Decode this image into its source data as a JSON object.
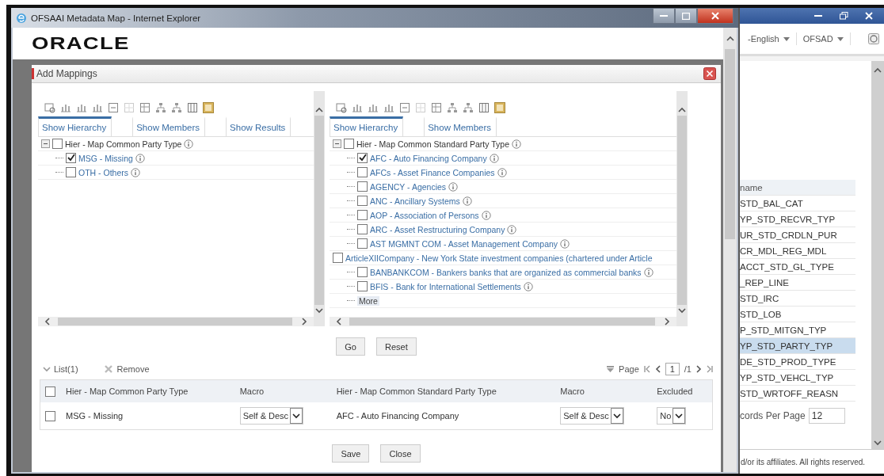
{
  "background_window": {
    "language": "-English",
    "user": "OFSAD",
    "column_header": "name",
    "rows": [
      {
        "text": "STD_BAL_CAT",
        "selected": false
      },
      {
        "text": "YP_STD_RECVR_TYP",
        "selected": false
      },
      {
        "text": "UR_STD_CRDLN_PUR",
        "selected": false
      },
      {
        "text": "CR_MDL_REG_MDL",
        "selected": false
      },
      {
        "text": "ACCT_STD_GL_TYPE",
        "selected": false
      },
      {
        "text": "_REP_LINE",
        "selected": false
      },
      {
        "text": "STD_IRC",
        "selected": false
      },
      {
        "text": "STD_LOB",
        "selected": false
      },
      {
        "text": "P_STD_MITGN_TYP",
        "selected": false
      },
      {
        "text": "YP_STD_PARTY_TYP",
        "selected": true
      },
      {
        "text": "DE_STD_PROD_TYPE",
        "selected": false
      },
      {
        "text": "YP_STD_VEHCL_TYP",
        "selected": false
      },
      {
        "text": "STD_WRTOFF_REASN",
        "selected": false
      }
    ],
    "records_per_page_label": "cords Per Page",
    "records_per_page": "12",
    "footer": "d/or its affiliates. All rights reserved."
  },
  "window": {
    "title": "OFSAAI Metadata Map - Internet Explorer"
  },
  "logo": "ORACLE",
  "dialog": {
    "title": "Add Mappings",
    "panels": [
      {
        "tabs": [
          {
            "label": "Show Hierarchy",
            "selected": true
          },
          {
            "label": "Show Members",
            "selected": false
          },
          {
            "label": "Show Results",
            "selected": false
          }
        ],
        "tree": [
          {
            "label": "Hier - Map Common Party Type",
            "checked": false,
            "expanded": true,
            "info": true,
            "children": [
              {
                "label": "MSG - Missing",
                "checked": true,
                "info": true
              },
              {
                "label": "OTH - Others",
                "checked": false,
                "info": true
              }
            ]
          }
        ]
      },
      {
        "tabs": [
          {
            "label": "Show Hierarchy",
            "selected": true
          },
          {
            "label": "Show Members",
            "selected": false
          }
        ],
        "tree": [
          {
            "label": "Hier - Map Common Standard Party Type",
            "checked": false,
            "expanded": true,
            "info": true,
            "children": [
              {
                "label": "AFC - Auto Financing Company",
                "checked": true,
                "info": true
              },
              {
                "label": "AFCs - Asset Finance Companies",
                "checked": false,
                "info": true
              },
              {
                "label": "AGENCY - Agencies",
                "checked": false,
                "info": true
              },
              {
                "label": "ANC - Ancillary Systems",
                "checked": false,
                "info": true
              },
              {
                "label": "AOP - Association of Persons",
                "checked": false,
                "info": true
              },
              {
                "label": "ARC - Asset Restructuring Company",
                "checked": false,
                "info": true
              },
              {
                "label": "AST MGMNT COM - Asset Management Company",
                "checked": false,
                "info": true
              }
            ]
          },
          {
            "label": "ArticleXIICompany - New York State investment companies (chartered under Article",
            "checked": false,
            "info": false,
            "children": [
              {
                "label": "BANBANKCOM - Bankers banks that are organized as commercial banks",
                "checked": false,
                "info": true
              },
              {
                "label": "BFIS - Bank for International Settlements",
                "checked": false,
                "info": true
              },
              {
                "kind": "more",
                "label": "More"
              }
            ]
          }
        ]
      }
    ],
    "buttons": [
      "Go",
      "Reset"
    ],
    "list": {
      "title": "List(1)",
      "remove": "Remove",
      "page_label": "Page",
      "page": "1",
      "page_total": "/1",
      "all_checked": false,
      "columns": [
        "Hier - Map Common Party Type",
        "Macro",
        "Hier - Map Common Standard Party Type",
        "Macro",
        "Excluded"
      ],
      "rows": [
        {
          "checked": false,
          "cells": [
            {
              "kind": "text",
              "value": "MSG - Missing"
            },
            {
              "kind": "select",
              "value": "Self & Desc"
            },
            {
              "kind": "text",
              "value": "AFC - Auto Financing Company"
            },
            {
              "kind": "select",
              "value": "Self & Desc"
            },
            {
              "kind": "select",
              "value": "No"
            }
          ]
        }
      ]
    },
    "footer_buttons": [
      "Save",
      "Close"
    ]
  }
}
